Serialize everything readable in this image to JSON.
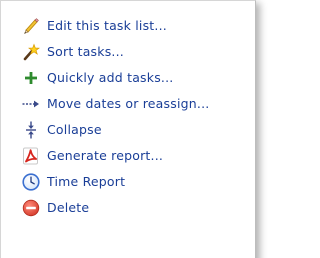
{
  "menu": {
    "items": [
      {
        "label": "Edit this task list...",
        "icon": "pencil-icon"
      },
      {
        "label": "Sort tasks...",
        "icon": "magic-wand-icon"
      },
      {
        "label": "Quickly add tasks...",
        "icon": "plus-icon"
      },
      {
        "label": "Move dates or reassign...",
        "icon": "dashed-arrow-right-icon"
      },
      {
        "label": "Collapse",
        "icon": "collapse-arrows-icon"
      },
      {
        "label": "Generate report...",
        "icon": "pdf-icon"
      },
      {
        "label": "Time Report",
        "icon": "clock-icon"
      },
      {
        "label": "Delete",
        "icon": "delete-icon"
      }
    ]
  },
  "colors": {
    "label": "#1a3e97",
    "plus": "#2e8b2e",
    "delete": "#e04a3a",
    "clock": "#3a6fd0"
  }
}
